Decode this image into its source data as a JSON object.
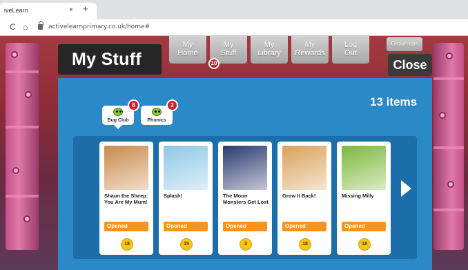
{
  "browser": {
    "tab_title": "iveLearn",
    "tab_close": "×",
    "new_tab": "+",
    "back": "C",
    "home": "⌂",
    "url": "activelearnprimary.co.uk/home#"
  },
  "page": {
    "title": "My Stuff",
    "nav": [
      {
        "label_line1": "My",
        "label_line2": "Home"
      },
      {
        "label_line1": "My",
        "label_line2": "Stuff"
      },
      {
        "label_line1": "My",
        "label_line2": "Library"
      },
      {
        "label_line1": "My",
        "label_line2": "Rewards"
      },
      {
        "label_line1": "Log",
        "label_line2": "Out"
      }
    ],
    "stuff_badge": "10",
    "grownups": "Grown-ups",
    "close": "Close",
    "items_count": "13 items",
    "filters": [
      {
        "label": "Bug Club",
        "count": "8",
        "icon": "bug-club-icon"
      },
      {
        "label": "Phonics",
        "count": "2",
        "icon": "phonics-icon"
      }
    ],
    "books": [
      {
        "title": "Shaun the Sheep: You Are My Mum!",
        "status": "Opened",
        "level": "18",
        "cover_color": "#c98a4a"
      },
      {
        "title": "Splash!",
        "status": "Opened",
        "level": "15",
        "cover_color": "#8ec7e6"
      },
      {
        "title": "The Moon Monsters Get Lost",
        "status": "Opened",
        "level": "3",
        "cover_color": "#2b3a6e"
      },
      {
        "title": "Grow It Back!",
        "status": "Opened",
        "level": "18",
        "cover_color": "#d9a25a"
      },
      {
        "title": "Missing Milly",
        "status": "Opened",
        "level": "18",
        "cover_color": "#7cb83a"
      }
    ],
    "next_icon": "chevron-right-icon",
    "colors": {
      "panel_blue": "#2b89c8",
      "opened_orange": "#f7941d",
      "level_yellow": "#f9c514",
      "badge_red": "#d0202e"
    }
  }
}
